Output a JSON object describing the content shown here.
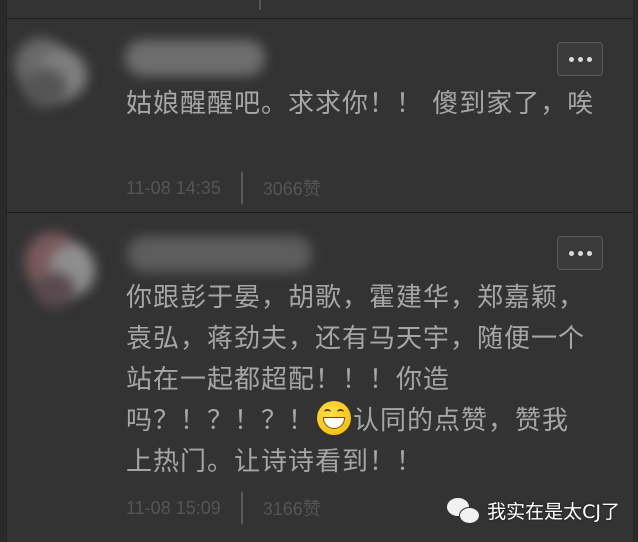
{
  "comments": [
    {
      "text": "姑娘醒醒吧。求求你！！ 傻到家了，唉",
      "time": "11-08 14:35",
      "likes": "3066赞",
      "avatar_colors": [
        "#6a6a6a",
        "#8a8a8a",
        "#4f4f4f"
      ]
    },
    {
      "text_before_emoji": "你跟彭于晏，胡歌，霍建华，郑嘉颖，袁弘，蒋劲夫，还有马天宇，随便一个站在一起都超配！！！你造吗？！？！？！",
      "text_after_emoji": "认同的点赞，赞我上热门。让诗诗看到！！",
      "emoji": "grin-emoji",
      "time": "11-08 15:09",
      "likes": "3166赞",
      "avatar_colors": [
        "#7a5a5c",
        "#9a9a9a",
        "#5a4a50"
      ]
    }
  ],
  "watermark": {
    "text": "我实在是太CJ了",
    "icon": "wechat-icon"
  },
  "colors": {
    "background": "#333333",
    "text": "#a6a6a6",
    "meta": "#555555",
    "emoji": "#f2b800"
  }
}
